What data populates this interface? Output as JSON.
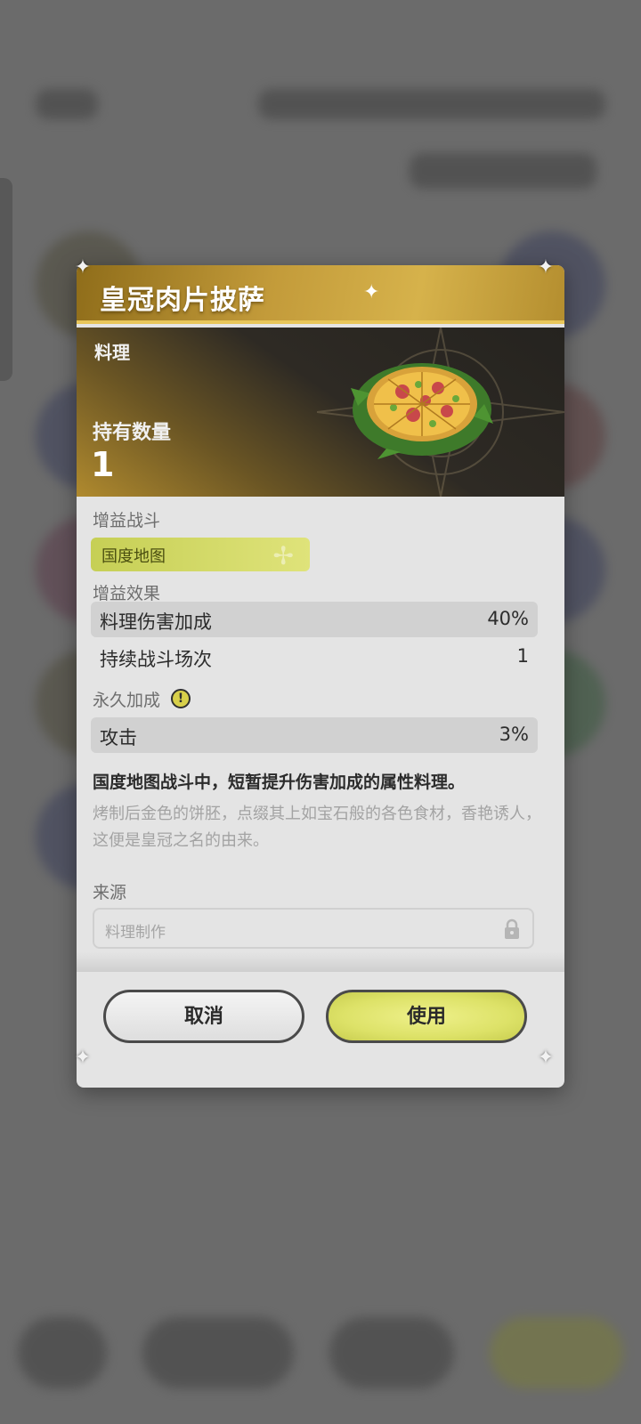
{
  "dialog": {
    "title": "皇冠肉片披萨",
    "category": "料理",
    "owned_label": "持有数量",
    "owned_count": "1",
    "buff_battle": {
      "label": "增益战斗",
      "tag": "国度地图"
    },
    "buff_effect": {
      "label": "增益效果",
      "rows": [
        {
          "name": "料理伤害加成",
          "value": "40%"
        },
        {
          "name": "持续战斗场次",
          "value": "1"
        }
      ]
    },
    "permanent_bonus": {
      "label": "永久加成",
      "rows": [
        {
          "name": "攻击",
          "value": "3%"
        }
      ]
    },
    "summary": "国度地图战斗中，短暂提升伤害加成的属性料理。",
    "flavor": "烤制后金色的饼胚，点缀其上如宝石般的各色食材，香艳诱人，这便是皇冠之名的由来。",
    "source": {
      "label": "来源",
      "value": "料理制作"
    },
    "buttons": {
      "cancel": "取消",
      "use": "使用"
    }
  },
  "colors": {
    "accent_gold": "#c39b3a",
    "use_button": "#dde268",
    "tag_chip": "#c6cf55"
  },
  "icons": [
    "info-icon",
    "lock-icon",
    "sparkle-icon",
    "corner-ornament-icon",
    "pizza-item-icon"
  ]
}
